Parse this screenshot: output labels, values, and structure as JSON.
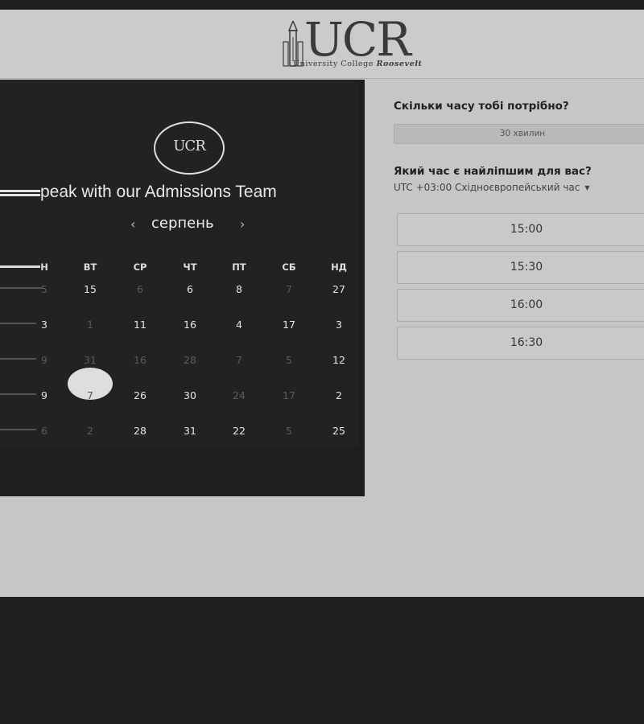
{
  "header": {
    "logo_text": "UCR",
    "logo_tagline_plain": "University College ",
    "logo_tagline_italic": "Roosevelt"
  },
  "panel": {
    "badge_text": "UCR",
    "title": "peak with our Admissions Team",
    "month": "серпень",
    "prev_arrow": "‹",
    "next_arrow": "›",
    "weekdays": [
      "Н",
      "ВТ",
      "СР",
      "ЧТ",
      "ПТ",
      "СБ",
      "НД"
    ],
    "rows": [
      [
        "5",
        "15",
        "6",
        "6",
        "8",
        "7",
        "27"
      ],
      [
        "3",
        "1",
        "11",
        "16",
        "4",
        "17",
        "3"
      ],
      [
        "9",
        "31",
        "16",
        "28",
        "7",
        "5",
        "12"
      ],
      [
        "9",
        "7",
        "26",
        "30",
        "24",
        "17",
        "2"
      ],
      [
        "6",
        "2",
        "28",
        "31",
        "22",
        "5",
        "25"
      ]
    ]
  },
  "booking": {
    "duration_question": "Скільки часу тобі потрібно?",
    "duration_value": "30 хвилин",
    "time_question": "Який час є найліпшим для вас?",
    "timezone": "UTC +03:00 Східноєвропейський час",
    "slots": [
      "15:00",
      "15:30",
      "16:00",
      "16:30"
    ]
  }
}
